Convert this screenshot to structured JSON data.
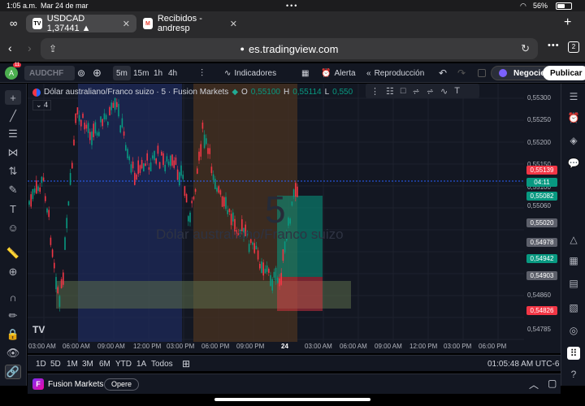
{
  "status_bar": {
    "time": "1:05 a.m.",
    "date": "Mar 24 de mar",
    "battery": "56%"
  },
  "tabs": [
    {
      "label": "USDCAD 1,37441 ▲",
      "favicon": "TV"
    },
    {
      "label": "Recibidos - andresp",
      "favicon": "M"
    }
  ],
  "address": {
    "url": "es.tradingview.com",
    "tabs_count": "2"
  },
  "toolbar": {
    "symbol": "AUDCHF",
    "avatar_badge": "11",
    "interval_active": "5m",
    "intervals": [
      "15m",
      "1h",
      "4h"
    ],
    "indicators": "Indicadores",
    "alert": "Alerta",
    "replay": "Reproducción",
    "trade": "Negocie",
    "publish": "Publicar"
  },
  "legend": {
    "title": "Dólar australiano/Franco suizo · 5 · Fusion Markets",
    "o_label": "O",
    "o_value": "0,55100",
    "h_label": "H",
    "h_value": "0,55114",
    "l_label": "L",
    "l_value": "0,550",
    "collapse": "4"
  },
  "watermark": {
    "interval": "5",
    "symbol": "Dólar australiano/Franco suizo"
  },
  "price_scale": {
    "labels": [
      "0,55300",
      "0,55250",
      "0,55200",
      "0,55150",
      "0,55100",
      "0,55060",
      "0,54860",
      "0,54785"
    ],
    "badges": [
      {
        "text": "0,55139",
        "color": "#f23645"
      },
      {
        "text": "04:11",
        "color": "#089981"
      },
      {
        "text": "0,55082",
        "color": "#089981"
      },
      {
        "text": "0,55020",
        "color": "#5d606b"
      },
      {
        "text": "0,54978",
        "color": "#5d606b"
      },
      {
        "text": "0,54942",
        "color": "#089981"
      },
      {
        "text": "0,54903",
        "color": "#5d606b"
      },
      {
        "text": "0,54826",
        "color": "#f23645"
      }
    ]
  },
  "time_scale": [
    "03:00 AM",
    "06:00 AM",
    "09:00 AM",
    "12:00 PM",
    "03:00 PM",
    "06:00 PM",
    "09:00 PM",
    "24",
    "03:00 AM",
    "06:00 AM",
    "09:00 AM",
    "12:00 PM",
    "03:00 PM",
    "06:00 PM"
  ],
  "ranges": [
    "1D",
    "5D",
    "1M",
    "3M",
    "6M",
    "YTD",
    "1A",
    "Todos"
  ],
  "clock": "01:05:48 AM UTC-6",
  "broker": {
    "name": "Fusion Markets",
    "action": "Opere"
  },
  "colors": {
    "up": "#089981",
    "down": "#f23645",
    "bg": "#131722"
  }
}
